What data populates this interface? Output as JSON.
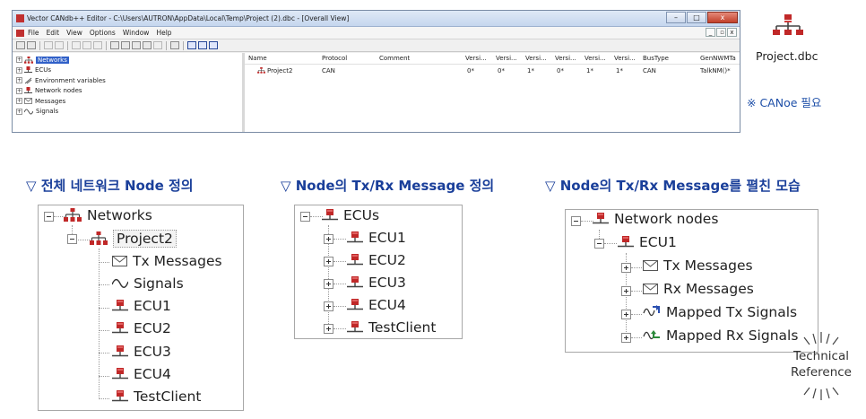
{
  "window": {
    "title": "Vector CANdb++ Editor - C:\\Users\\AUTRON\\AppData\\Local\\Temp\\Project (2).dbc - [Overall View]",
    "menu": [
      "File",
      "Edit",
      "View",
      "Options",
      "Window",
      "Help"
    ],
    "window_buttons": [
      "–",
      "□",
      "x"
    ],
    "mdi_buttons": [
      "_",
      " ▫",
      "x"
    ],
    "tree": {
      "items": [
        {
          "label": "Networks",
          "icon": "network-icon",
          "selected": true
        },
        {
          "label": "ECUs",
          "icon": "ecu-icon"
        },
        {
          "label": "Environment variables",
          "icon": "environment-variable-icon"
        },
        {
          "label": "Network nodes",
          "icon": "network-node-icon"
        },
        {
          "label": "Messages",
          "icon": "message-envelope-icon"
        },
        {
          "label": "Signals",
          "icon": "signal-wave-icon"
        }
      ]
    },
    "grid": {
      "headers": [
        "Name",
        "Protocol",
        "Comment",
        "Versi...",
        "Versi...",
        "Versi...",
        "Versi...",
        "Versi...",
        "Versi...",
        "BusType",
        "GenNWMTa"
      ],
      "row": [
        "Project2",
        "CAN",
        "",
        "0*",
        "0*",
        "1*",
        "0*",
        "1*",
        "1*",
        "CAN",
        "TalkNM()*"
      ]
    }
  },
  "file": {
    "name": "Project.dbc",
    "icon": "network-icon"
  },
  "note": "※ CANoe 필요",
  "sections": [
    {
      "heading": "▽ 전체 네트워크 Node 정의",
      "root": "Networks",
      "child": "Project2",
      "items": [
        "Tx Messages",
        "Signals",
        "ECU1",
        "ECU2",
        "ECU3",
        "ECU4",
        "TestClient"
      ]
    },
    {
      "heading": "▽ Node의 Tx/Rx Message 정의",
      "root": "ECUs",
      "items": [
        "ECU1",
        "ECU2",
        "ECU3",
        "ECU4",
        "TestClient"
      ]
    },
    {
      "heading": "▽ Node의 Tx/Rx Message를 펼친 모습",
      "root": "Network nodes",
      "child": "ECU1",
      "items": [
        "Tx Messages",
        "Rx Messages",
        "Mapped Tx Signals",
        "Mapped Rx Signals"
      ]
    }
  ],
  "watermark": {
    "line1": "Technical",
    "line2": "Reference"
  },
  "colors": {
    "heading": "#1a3f9a",
    "note": "#1e4fa8",
    "ecu_red": "#c02828",
    "selection": "#3060c8"
  }
}
